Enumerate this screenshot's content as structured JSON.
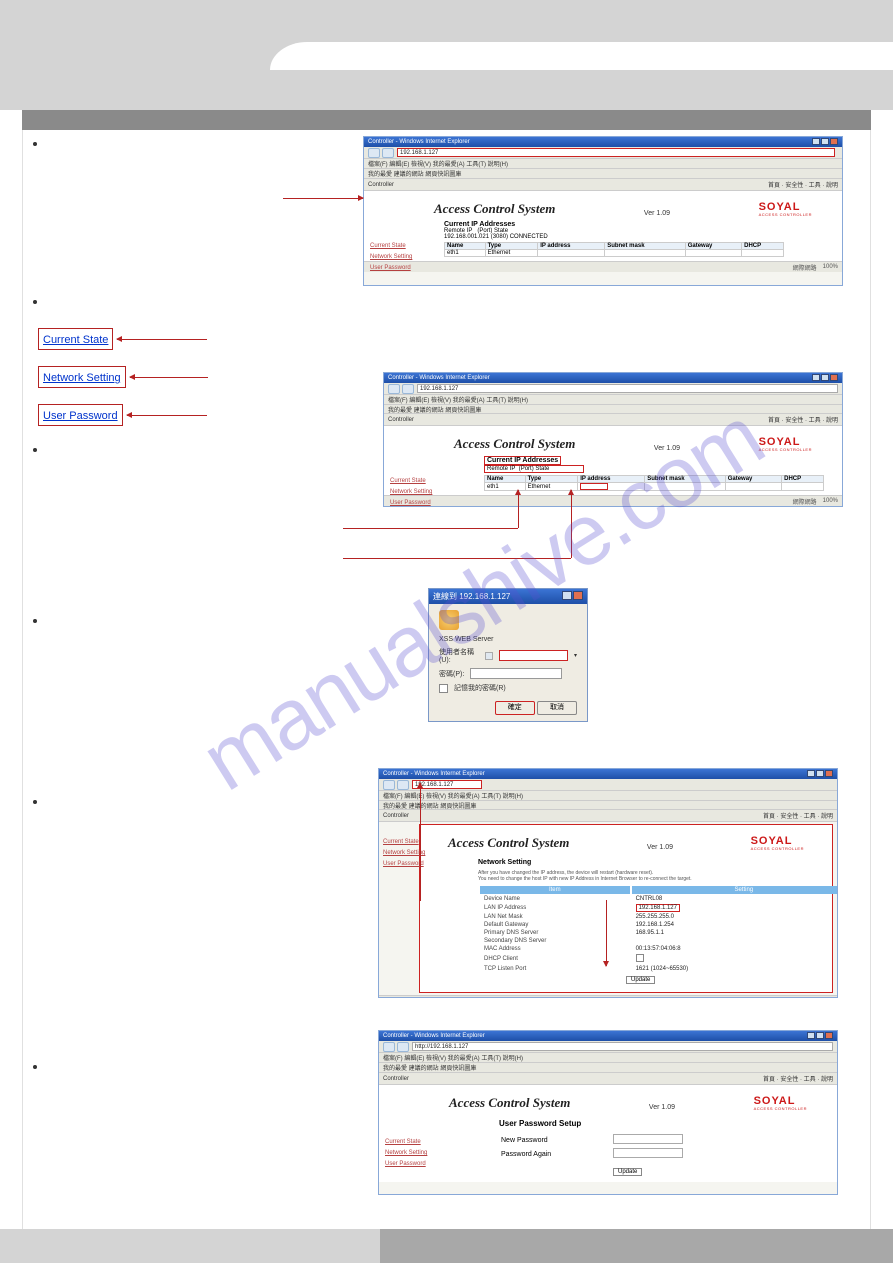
{
  "links": {
    "current_state": "Current State",
    "network_setting": "Network Setting",
    "user_password": "User Password"
  },
  "watermark": "manualshive.com",
  "ie": {
    "title": "Controller - Windows Internet Explorer",
    "addr1": "192.168.1.127",
    "addr_prefix": "http://",
    "menu": "檔案(F)  編輯(E)  檢視(V)  我的最愛(A)  工具(T)  說明(H)",
    "favbar": "我的最愛  建議的網站  網頁快訊圖庫",
    "tab": "Controller",
    "rightmenu": "首頁 · 安全性 · 工具 · 說明",
    "status_net": "網際網路",
    "status_zoom": "100%"
  },
  "acs": {
    "title": "Access Control System",
    "version": "Ver 1.09",
    "brand": "SOYAL",
    "brand_sub": "ACCESS CONTROLLER",
    "side": {
      "cs": "Current State",
      "ns": "Network Setting",
      "up": "User Password"
    },
    "ip_section_title": "Current IP Addresses",
    "ip_remote": "Remote IP",
    "ip_port": "(Port) State",
    "ip_line": "192.168.001.021 (3080) CONNECTED",
    "table_hdr": {
      "name": "Name",
      "type": "Type",
      "ip": "IP address",
      "subnet": "Subnet mask",
      "gateway": "Gateway",
      "dhcp": "DHCP"
    },
    "row": {
      "name": "eth1",
      "type": "Ethernet"
    }
  },
  "dialog": {
    "title": "連線到 192.168.1.127",
    "server": "XSS WEB Server",
    "user_lbl": "使用者名稱(U):",
    "pass_lbl": "密碼(P):",
    "remember": "記憶我的密碼(R)",
    "ok": "確定",
    "cancel": "取消"
  },
  "netset": {
    "heading": "Network Setting",
    "note1": "After you have changed the IP address, the device will restart (hardware reset).",
    "note2": "You need to change the host IP with new IP Address in Internet Browser to re-connect the target.",
    "col_item": "Item",
    "col_setting": "Setting",
    "rows": {
      "device": "Device Name",
      "device_v": "CNTRL08",
      "lanip": "LAN IP Address",
      "lanip_v": "192.168.1.127",
      "mask": "LAN Net Mask",
      "mask_v": "255.255.255.0",
      "gw": "Default Gateway",
      "gw_v": "192.168.1.254",
      "dns1": "Primary DNS Server",
      "dns1_v": "168.95.1.1",
      "dns2": "Secondary DNS Server",
      "dns2_v": "",
      "mac": "MAC Address",
      "mac_v": "00:13:57:04:06:8",
      "dhcp": "DHCP Client",
      "tcp": "TCP Listen Port",
      "tcp_v": "1621  (1024~65530)"
    },
    "update": "Update"
  },
  "userpw": {
    "heading": "User Password Setup",
    "new": "New Password",
    "again": "Password Again",
    "update": "Update"
  }
}
